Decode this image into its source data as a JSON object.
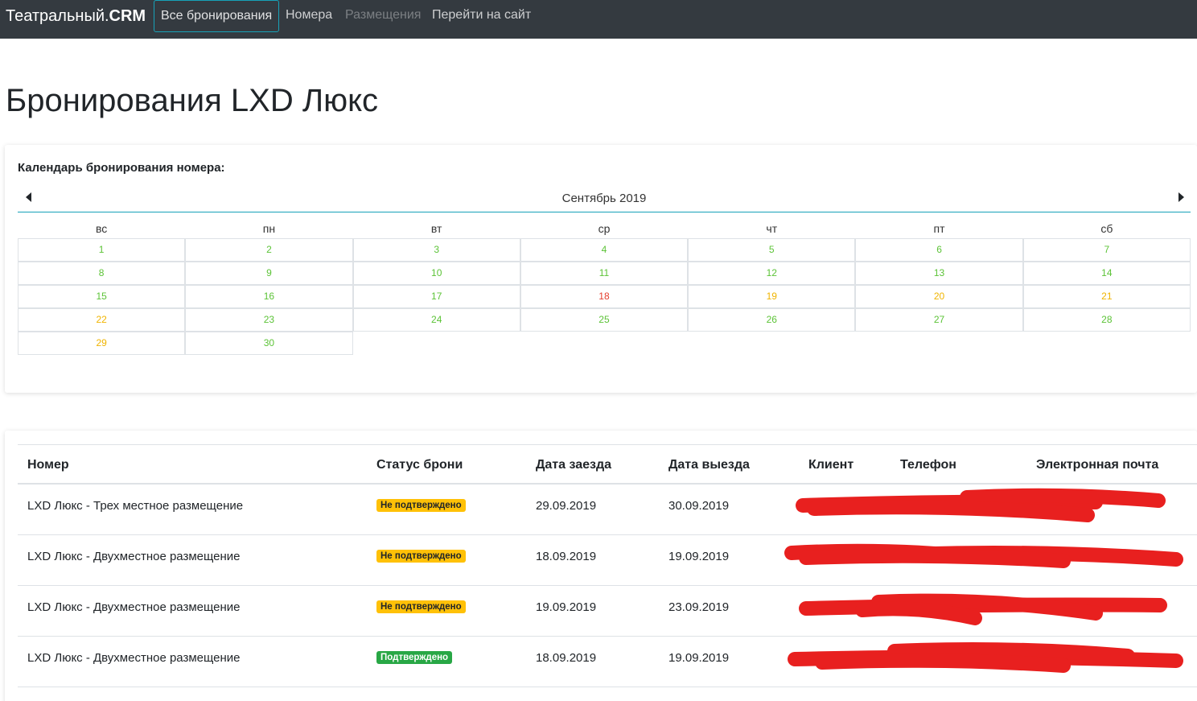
{
  "navbar": {
    "brand_prefix": "Театральный.",
    "brand_bold": "CRM",
    "links": [
      {
        "label": "Все бронирования",
        "state": "active"
      },
      {
        "label": "Номера",
        "state": "normal"
      },
      {
        "label": "Размещения",
        "state": "disabled"
      },
      {
        "label": "Перейти на сайт",
        "state": "normal"
      }
    ]
  },
  "page": {
    "title": "Бронирования LXD Люкс"
  },
  "calendar": {
    "heading": "Календарь бронирования номера:",
    "month_label": "Сентябрь 2019",
    "weekdays": [
      "вс",
      "пн",
      "вт",
      "ср",
      "чт",
      "пт",
      "сб"
    ],
    "colors": {
      "free": "#5cc337",
      "booked": "#e53e2e",
      "pending": "#f0b400"
    },
    "weeks": [
      [
        {
          "d": "1",
          "s": "free"
        },
        {
          "d": "2",
          "s": "free"
        },
        {
          "d": "3",
          "s": "free"
        },
        {
          "d": "4",
          "s": "free"
        },
        {
          "d": "5",
          "s": "free"
        },
        {
          "d": "6",
          "s": "free"
        },
        {
          "d": "7",
          "s": "free"
        }
      ],
      [
        {
          "d": "8",
          "s": "free"
        },
        {
          "d": "9",
          "s": "free"
        },
        {
          "d": "10",
          "s": "free"
        },
        {
          "d": "11",
          "s": "free"
        },
        {
          "d": "12",
          "s": "free"
        },
        {
          "d": "13",
          "s": "free"
        },
        {
          "d": "14",
          "s": "free"
        }
      ],
      [
        {
          "d": "15",
          "s": "free"
        },
        {
          "d": "16",
          "s": "free"
        },
        {
          "d": "17",
          "s": "free"
        },
        {
          "d": "18",
          "s": "booked"
        },
        {
          "d": "19",
          "s": "pending"
        },
        {
          "d": "20",
          "s": "pending"
        },
        {
          "d": "21",
          "s": "pending"
        }
      ],
      [
        {
          "d": "22",
          "s": "pending"
        },
        {
          "d": "23",
          "s": "free"
        },
        {
          "d": "24",
          "s": "free"
        },
        {
          "d": "25",
          "s": "free"
        },
        {
          "d": "26",
          "s": "free"
        },
        {
          "d": "27",
          "s": "free"
        },
        {
          "d": "28",
          "s": "free"
        }
      ],
      [
        {
          "d": "29",
          "s": "pending"
        },
        {
          "d": "30",
          "s": "free"
        }
      ]
    ]
  },
  "bookings": {
    "columns": [
      "Номер",
      "Статус брони",
      "Дата заезда",
      "Дата выезда",
      "Клиент",
      "Телефон",
      "Электронная почта"
    ],
    "rows": [
      {
        "room": "LXD Люкс - Трех местное размещение",
        "status": "Не подтверждено",
        "status_type": "warn",
        "checkin": "29.09.2019",
        "checkout": "30.09.2019"
      },
      {
        "room": "LXD Люкс - Двухместное размещение",
        "status": "Не подтверждено",
        "status_type": "warn",
        "checkin": "18.09.2019",
        "checkout": "19.09.2019"
      },
      {
        "room": "LXD Люкс - Двухместное размещение",
        "status": "Не подтверждено",
        "status_type": "warn",
        "checkin": "19.09.2019",
        "checkout": "23.09.2019"
      },
      {
        "room": "LXD Люкс - Двухместное размещение",
        "status": "Подтверждено",
        "status_type": "ok",
        "checkin": "18.09.2019",
        "checkout": "19.09.2019"
      }
    ],
    "redaction_color": "#e8201f"
  }
}
